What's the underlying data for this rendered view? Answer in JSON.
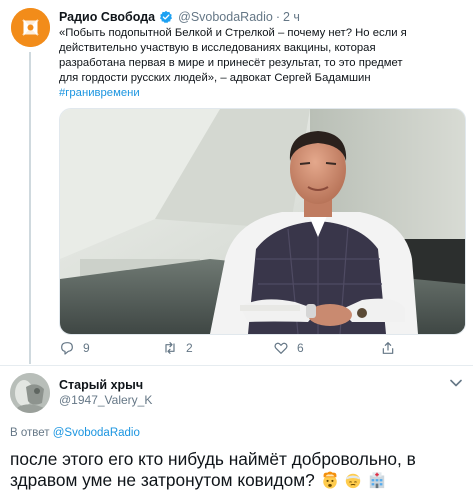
{
  "tweet": {
    "author_name": "Радио Свобода",
    "handle": "@SvobodaRadio",
    "separator": "·",
    "time": "2 ч",
    "text_lines": [
      "«Побыть подопытной Белкой и Стрелкой – почему нет? Но если я",
      "действительно участвую в исследованиях вакцины, которая",
      "разработана первая в мире и принесёт результат, то это предмет",
      "для гордости русских людей», – адвокат Сергей Бадамшин"
    ],
    "hashtag": "#гранивремени",
    "counts": {
      "replies": "9",
      "retweets": "2",
      "likes": "6"
    },
    "icons": [
      "radio-svoboda-logo-icon",
      "verified-badge-icon",
      "reply-icon",
      "retweet-icon",
      "like-icon",
      "share-icon"
    ],
    "colors": {
      "brand_orange": "#f28c1a",
      "link_blue": "#1b95e0",
      "muted": "#657786"
    }
  },
  "reply": {
    "author_name": "Старый хрыч",
    "handle": "@1947_Valery_K",
    "reply_to_prefix": "В ответ",
    "reply_to_handle": "@SvobodaRadio",
    "text": "после этого его кто нибудь наймёт добровольно, в здравом уме не затронутом ковидом?",
    "emojis": [
      "exploding-head-emoji",
      "face-with-head-bandage-emoji",
      "hospital-emoji"
    ]
  }
}
